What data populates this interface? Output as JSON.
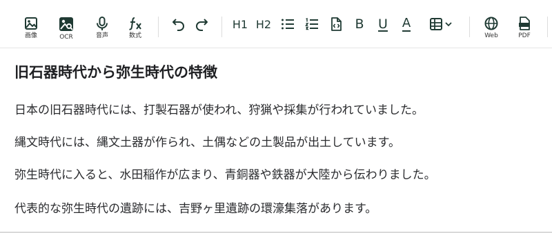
{
  "toolbar": {
    "image_label": "画像",
    "ocr_label": "OCR",
    "voice_label": "音声",
    "formula_label": "数式",
    "h1_label": "H1",
    "h2_label": "H2",
    "bold_label": "B",
    "underline_label": "U",
    "font_color_label": "A",
    "web_label": "Web",
    "pdf_label": "PDF",
    "icon_color": "#1f3a33"
  },
  "document": {
    "title": "旧石器時代から弥生時代の特徴",
    "paragraphs": [
      "日本の旧石器時代には、打製石器が使われ、狩猟や採集が行われていました。",
      "縄文時代には、縄文土器が作られ、土偶などの土製品が出土しています。",
      "弥生時代に入ると、水田稲作が広まり、青銅器や鉄器が大陸から伝わりました。",
      "代表的な弥生時代の遺跡には、吉野ヶ里遺跡の環濠集落があります。"
    ]
  }
}
